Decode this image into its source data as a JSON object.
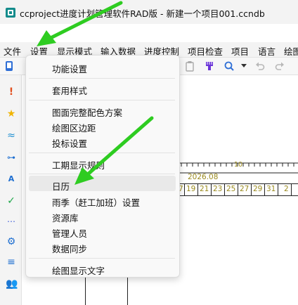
{
  "window": {
    "title": "ccproject进度计划管理软件RAD版 - 新建一个项目001.ccndb"
  },
  "menubar": {
    "items": [
      "文件",
      "设置",
      "显示模式",
      "输入数据",
      "进度控制",
      "项目检查",
      "项目",
      "语言",
      "绘图"
    ]
  },
  "dropdown": {
    "groups": [
      [
        "功能设置"
      ],
      [
        "套用样式"
      ],
      [
        "图面完整配色方案",
        "绘图区边距",
        "投标设置"
      ],
      [
        "工期显示规则"
      ],
      [
        "日历",
        "雨季（赶工加班）设置",
        "资源库",
        "管理人员",
        "数据同步"
      ],
      [
        "绘图显示文字"
      ]
    ],
    "highlighted": "日历"
  },
  "gantt": {
    "timeline_label": "2026.08",
    "week_marker": "10",
    "day_numbers": [
      "7",
      "19",
      "21",
      "23",
      "25",
      "27",
      "29",
      "31",
      "2"
    ]
  },
  "colors": {
    "accent": "#138b8b",
    "annotation_arrow": "#2ecc21"
  }
}
